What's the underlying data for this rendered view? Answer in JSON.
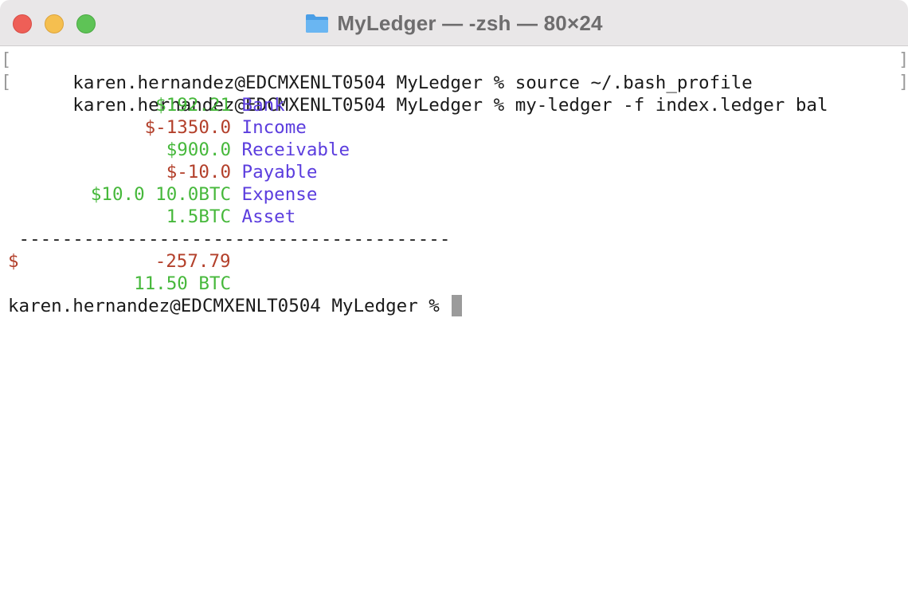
{
  "window": {
    "title": "MyLedger — -zsh — 80×24",
    "title_icon": "folder-icon",
    "buttons": [
      "close-button",
      "minimize-button",
      "maximize-button"
    ]
  },
  "terminal": {
    "prompt": "karen.hernandez@EDCMXENLT0504 MyLedger % ",
    "commands": [
      "source ~/.bash_profile",
      "my-ledger -f index.ledger bal"
    ],
    "balances": [
      {
        "amount": "$192.21",
        "account": "Bank",
        "color": "green"
      },
      {
        "amount": "$-1350.0",
        "account": "Income",
        "color": "red"
      },
      {
        "amount": "$900.0",
        "account": "Receivable",
        "color": "green"
      },
      {
        "amount": "$-10.0",
        "account": "Payable",
        "color": "red"
      },
      {
        "amount": "$10.0 10.0BTC",
        "account": "Expense",
        "color": "green"
      },
      {
        "amount": "1.5BTC",
        "account": "Asset",
        "color": "green"
      }
    ],
    "separator": "----------------------------------------",
    "totals": {
      "currency_symbol": "$",
      "usd_total": "-257.79",
      "btc_total": "11.50 BTC"
    }
  },
  "colors": {
    "positive": "#46b83b",
    "negative": "#b3402b",
    "account": "#5b3dde",
    "titlebar": "#e9e7e8"
  }
}
